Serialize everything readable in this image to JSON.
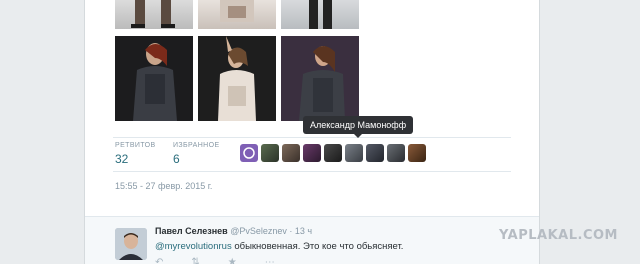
{
  "tweet": {
    "retweets_label": "РЕТВИТОВ",
    "retweets_count": "32",
    "favorites_label": "ИЗБРАННОЕ",
    "favorites_count": "6",
    "tooltip": "Александр Мамонофф",
    "timestamp": "15:55 - 27 февр. 2015 г."
  },
  "reply": {
    "name": "Павел Селезнев",
    "handle": "@PvSeleznev",
    "separator": "·",
    "time": "13 ч",
    "mention": "@myrevolutionrus",
    "text": " обыкновенная. Это кое что обьясняет."
  },
  "watermark": "YAPLAKAL.COM",
  "colors": {
    "accent": "#2a6d7c",
    "muted": "#8899a6"
  }
}
